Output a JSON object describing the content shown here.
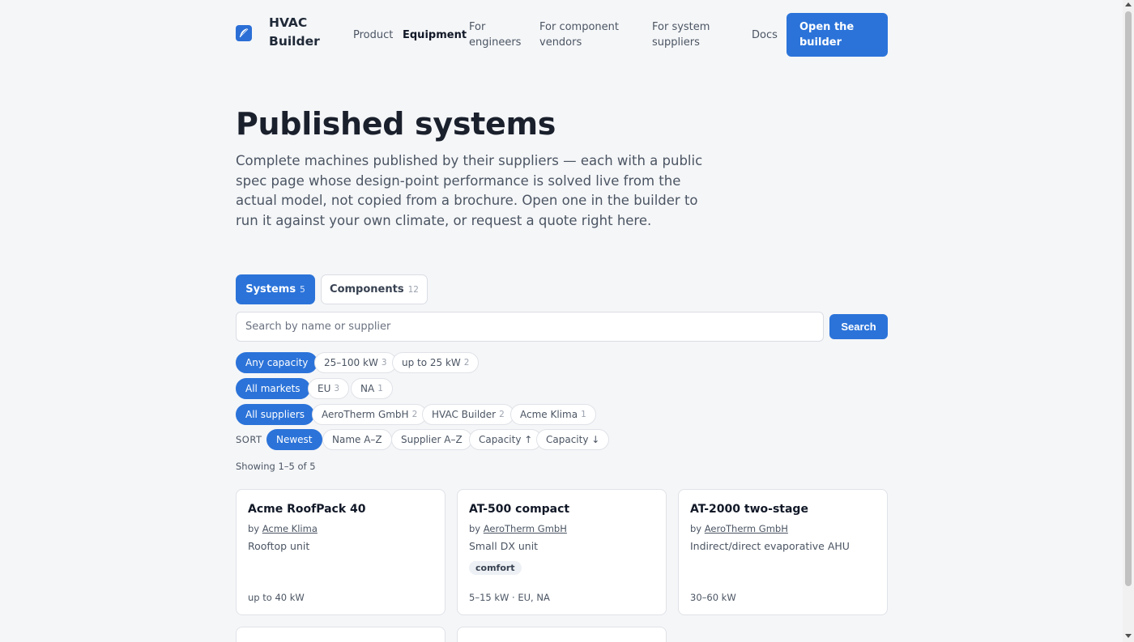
{
  "brand": {
    "name": "HVAC Builder",
    "icon": "brand-feather-icon",
    "accent": "#2b73d9"
  },
  "nav": {
    "items": [
      "Product",
      "Equipment",
      "For engineers",
      "For component vendors",
      "For system suppliers",
      "Docs"
    ],
    "active": "Equipment",
    "cta": "Open the builder"
  },
  "hero": {
    "title": "Published systems",
    "lead": "Complete machines published by their suppliers — each with a public spec page whose design-point performance is solved live from the actual model, not copied from a brochure. Open one in the builder to run it against your own climate, or request a quote right here."
  },
  "tabs": [
    {
      "label": "Systems",
      "count": "5",
      "active": true
    },
    {
      "label": "Components",
      "count": "12",
      "active": false
    }
  ],
  "search": {
    "placeholder": "Search by name or supplier",
    "value": "",
    "button": "Search"
  },
  "filters": {
    "capacity": [
      {
        "label": "Any capacity",
        "count": "",
        "active": true
      },
      {
        "label": "25–100 kW",
        "count": "3",
        "active": false
      },
      {
        "label": "up to 25 kW",
        "count": "2",
        "active": false
      }
    ],
    "markets": [
      {
        "label": "All markets",
        "count": "",
        "active": true
      },
      {
        "label": "EU",
        "count": "3",
        "active": false
      },
      {
        "label": "NA",
        "count": "1",
        "active": false
      }
    ],
    "suppliers": [
      {
        "label": "All suppliers",
        "count": "",
        "active": true
      },
      {
        "label": "AeroTherm GmbH",
        "count": "2",
        "active": false
      },
      {
        "label": "HVAC Builder",
        "count": "2",
        "active": false
      },
      {
        "label": "Acme Klima",
        "count": "1",
        "active": false
      }
    ]
  },
  "sort": {
    "label": "SORT",
    "options": [
      {
        "label": "Newest",
        "active": true
      },
      {
        "label": "Name A–Z",
        "active": false
      },
      {
        "label": "Supplier A–Z",
        "active": false
      },
      {
        "label": "Capacity ↑",
        "active": false
      },
      {
        "label": "Capacity ↓",
        "active": false
      }
    ]
  },
  "results": {
    "showing": "Showing 1–5 of 5",
    "cards": [
      {
        "name": "Acme RoofPack 40",
        "by": "by",
        "supplier": "Acme Klima",
        "type": "Rooftop unit",
        "tag": "",
        "footer": "up to 40 kW"
      },
      {
        "name": "AT-500 compact",
        "by": "by",
        "supplier": "AeroTherm GmbH",
        "type": "Small DX unit",
        "tag": "comfort",
        "footer": "5–15 kW · EU, NA"
      },
      {
        "name": "AT-2000 two-stage",
        "by": "by",
        "supplier": "AeroTherm GmbH",
        "type": "Indirect/direct evaporative AHU",
        "tag": "",
        "footer": "30–60 kW"
      }
    ]
  }
}
